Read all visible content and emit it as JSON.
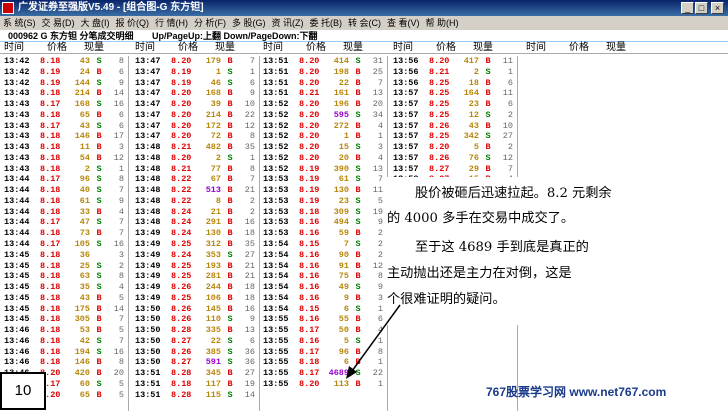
{
  "window": {
    "title": "广发证券至强版V5.49 - [组合图-G 东方钽]",
    "min": "_",
    "max": "□",
    "close": "×"
  },
  "menu": [
    "系 统(S)",
    "交 易(D)",
    "大 盘(I)",
    "报 价(Q)",
    "行 情(H)",
    "分 析(F)",
    "多 股(G)",
    "资 讯(Z)",
    "委 托(B)",
    "转 会(C)",
    "查 看(V)",
    "帮 助(H)"
  ],
  "info": {
    "stock": "000962 G 东方钽 分笔成交明细",
    "hint": "Up/PageUp:上翻 Down/PageDown:下翻"
  },
  "headers": {
    "time": "时间",
    "price": "价格",
    "volume": "现量"
  },
  "columns": [
    [
      [
        "13:42",
        "8.18",
        "43",
        "S",
        "8"
      ],
      [
        "13:42",
        "8.19",
        "24",
        "B",
        "6"
      ],
      [
        "13:42",
        "8.19",
        "144",
        "S",
        "9"
      ],
      [
        "13:43",
        "8.18",
        "214",
        "B",
        "14"
      ],
      [
        "13:43",
        "8.17",
        "168",
        "S",
        "16"
      ],
      [
        "13:43",
        "8.18",
        "65",
        "B",
        "6"
      ],
      [
        "13:43",
        "8.17",
        "43",
        "S",
        "6"
      ],
      [
        "13:43",
        "8.18",
        "146",
        "B",
        "17"
      ],
      [
        "13:43",
        "8.18",
        "11",
        "B",
        "3"
      ],
      [
        "13:43",
        "8.18",
        "54",
        "B",
        "12"
      ],
      [
        "13:43",
        "8.18",
        "2",
        "S",
        "1"
      ],
      [
        "13:44",
        "8.17",
        "96",
        "S",
        "8"
      ],
      [
        "13:44",
        "8.18",
        "40",
        "S",
        "7"
      ],
      [
        "13:44",
        "8.18",
        "61",
        "S",
        "9"
      ],
      [
        "13:44",
        "8.18",
        "33",
        "B",
        "4"
      ],
      [
        "13:44",
        "8.17",
        "47",
        "S",
        "7"
      ],
      [
        "13:44",
        "8.18",
        "73",
        "B",
        "7"
      ],
      [
        "13:44",
        "8.17",
        "105",
        "S",
        "16"
      ],
      [
        "13:45",
        "8.18",
        "36",
        "",
        "3"
      ],
      [
        "13:45",
        "8.18",
        "25",
        "S",
        "2"
      ],
      [
        "13:45",
        "8.18",
        "63",
        "S",
        "8"
      ],
      [
        "13:45",
        "8.18",
        "35",
        "S",
        "4"
      ],
      [
        "13:45",
        "8.18",
        "43",
        "B",
        "5"
      ],
      [
        "13:45",
        "8.18",
        "175",
        "B",
        "14"
      ],
      [
        "13:45",
        "8.18",
        "305",
        "B",
        "7"
      ],
      [
        "13:46",
        "8.18",
        "53",
        "B",
        "5"
      ],
      [
        "13:46",
        "8.18",
        "42",
        "S",
        "7"
      ],
      [
        "13:46",
        "8.18",
        "194",
        "S",
        "16"
      ],
      [
        "13:46",
        "8.18",
        "146",
        "B",
        "8"
      ],
      [
        "13:46",
        "8.20",
        "420",
        "B",
        "20"
      ],
      [
        "13:47",
        "8.17",
        "60",
        "S",
        "5"
      ],
      [
        "13:47",
        "8.20",
        "65",
        "B",
        "5"
      ]
    ],
    [
      [
        "13:47",
        "8.20",
        "179",
        "B",
        "7"
      ],
      [
        "13:47",
        "8.19",
        "1",
        "S",
        "1"
      ],
      [
        "13:47",
        "8.19",
        "46",
        "S",
        "6"
      ],
      [
        "13:47",
        "8.20",
        "168",
        "B",
        "9"
      ],
      [
        "13:47",
        "8.20",
        "39",
        "B",
        "10"
      ],
      [
        "13:47",
        "8.20",
        "214",
        "B",
        "22"
      ],
      [
        "13:47",
        "8.20",
        "172",
        "B",
        "12"
      ],
      [
        "13:47",
        "8.20",
        "72",
        "B",
        "8"
      ],
      [
        "13:48",
        "8.21",
        "482",
        "B",
        "35"
      ],
      [
        "13:48",
        "8.20",
        "2",
        "S",
        "1"
      ],
      [
        "13:48",
        "8.21",
        "77",
        "B",
        "8"
      ],
      [
        "13:48",
        "8.22",
        "67",
        "B",
        "7"
      ],
      [
        "13:48",
        "8.22",
        "513",
        "B",
        "21"
      ],
      [
        "13:48",
        "8.22",
        "8",
        "B",
        "2"
      ],
      [
        "13:48",
        "8.24",
        "21",
        "B",
        "2"
      ],
      [
        "13:48",
        "8.24",
        "291",
        "B",
        "16"
      ],
      [
        "13:49",
        "8.24",
        "130",
        "B",
        "18"
      ],
      [
        "13:49",
        "8.25",
        "312",
        "B",
        "35"
      ],
      [
        "13:49",
        "8.24",
        "353",
        "S",
        "27"
      ],
      [
        "13:49",
        "8.25",
        "193",
        "B",
        "21"
      ],
      [
        "13:49",
        "8.25",
        "281",
        "B",
        "21"
      ],
      [
        "13:49",
        "8.26",
        "244",
        "B",
        "18"
      ],
      [
        "13:49",
        "8.25",
        "106",
        "B",
        "18"
      ],
      [
        "13:50",
        "8.26",
        "145",
        "B",
        "16"
      ],
      [
        "13:50",
        "8.26",
        "110",
        "S",
        "9"
      ],
      [
        "13:50",
        "8.28",
        "335",
        "B",
        "13"
      ],
      [
        "13:50",
        "8.27",
        "22",
        "S",
        "6"
      ],
      [
        "13:50",
        "8.26",
        "385",
        "S",
        "36"
      ],
      [
        "13:50",
        "8.27",
        "591",
        "S",
        "36"
      ],
      [
        "13:51",
        "8.28",
        "345",
        "B",
        "27"
      ],
      [
        "13:51",
        "8.18",
        "117",
        "B",
        "19"
      ],
      [
        "13:51",
        "8.28",
        "115",
        "S",
        "14"
      ]
    ],
    [
      [
        "13:51",
        "8.20",
        "414",
        "S",
        "31"
      ],
      [
        "13:51",
        "8.20",
        "198",
        "B",
        "25"
      ],
      [
        "13:51",
        "8.20",
        "22",
        "B",
        "7"
      ],
      [
        "13:51",
        "8.21",
        "161",
        "B",
        "13"
      ],
      [
        "13:52",
        "8.20",
        "196",
        "B",
        "20"
      ],
      [
        "13:52",
        "8.20",
        "595",
        "S",
        "34"
      ],
      [
        "13:52",
        "8.20",
        "272",
        "B",
        "4"
      ],
      [
        "13:52",
        "8.20",
        "1",
        "B",
        "1"
      ],
      [
        "13:52",
        "8.20",
        "15",
        "S",
        "3"
      ],
      [
        "13:52",
        "8.20",
        "20",
        "B",
        "4"
      ],
      [
        "13:52",
        "8.19",
        "390",
        "S",
        "13"
      ],
      [
        "13:53",
        "8.19",
        "61",
        "S",
        "7"
      ],
      [
        "13:53",
        "8.19",
        "130",
        "B",
        "11"
      ],
      [
        "13:53",
        "8.19",
        "23",
        "S",
        "5"
      ],
      [
        "13:53",
        "8.18",
        "309",
        "S",
        "19"
      ],
      [
        "13:53",
        "8.16",
        "494",
        "S",
        "9"
      ],
      [
        "13:53",
        "8.16",
        "59",
        "B",
        "2"
      ],
      [
        "13:54",
        "8.15",
        "7",
        "S",
        "2"
      ],
      [
        "13:54",
        "8.16",
        "90",
        "B",
        "2"
      ],
      [
        "13:54",
        "8.16",
        "91",
        "B",
        "12"
      ],
      [
        "13:54",
        "8.16",
        "75",
        "B",
        "8"
      ],
      [
        "13:54",
        "8.16",
        "49",
        "S",
        "9"
      ],
      [
        "13:54",
        "8.16",
        "9",
        "B",
        "3"
      ],
      [
        "13:54",
        "8.15",
        "6",
        "S",
        "1"
      ],
      [
        "13:55",
        "8.16",
        "55",
        "B",
        "6"
      ],
      [
        "13:55",
        "8.17",
        "50",
        "B",
        "4"
      ],
      [
        "13:55",
        "8.16",
        "5",
        "S",
        "1"
      ],
      [
        "13:55",
        "8.17",
        "96",
        "B",
        "8"
      ],
      [
        "13:55",
        "8.18",
        "6",
        "B",
        "1"
      ],
      [
        "13:55",
        "8.17",
        "4689",
        "S",
        "22"
      ],
      [
        "13:55",
        "8.20",
        "113",
        "B",
        "1"
      ],
      [
        "",
        "",
        "",
        "",
        ""
      ]
    ],
    [
      [
        "13:56",
        "8.20",
        "417",
        "B",
        "11"
      ],
      [
        "13:56",
        "8.21",
        "2",
        "S",
        "1"
      ],
      [
        "13:56",
        "8.25",
        "18",
        "B",
        "6"
      ],
      [
        "13:57",
        "8.25",
        "164",
        "B",
        "11"
      ],
      [
        "13:57",
        "8.25",
        "23",
        "B",
        "6"
      ],
      [
        "13:57",
        "8.25",
        "12",
        "S",
        "2"
      ],
      [
        "13:57",
        "8.26",
        "43",
        "B",
        "10"
      ],
      [
        "13:57",
        "8.25",
        "342",
        "S",
        "27"
      ],
      [
        "13:57",
        "8.20",
        "5",
        "B",
        "2"
      ],
      [
        "13:57",
        "8.26",
        "76",
        "S",
        "12"
      ],
      [
        "13:57",
        "8.27",
        "29",
        "B",
        "7"
      ],
      [
        "13:58",
        "8.27",
        "15",
        "B",
        "4"
      ]
    ]
  ],
  "callout": {
    "line1": "股价被砸后迅速拉起。8.2 元剩余",
    "line2": "的 4000 多手在交易中成交了。",
    "line3": "至于这 4689 手到底是真正的",
    "line4": "主动抛出还是主力在对倒，这是",
    "line5": "个很难证明的疑问。"
  },
  "slide_number": "10",
  "watermark": "767股票学习网  www.net767.com"
}
